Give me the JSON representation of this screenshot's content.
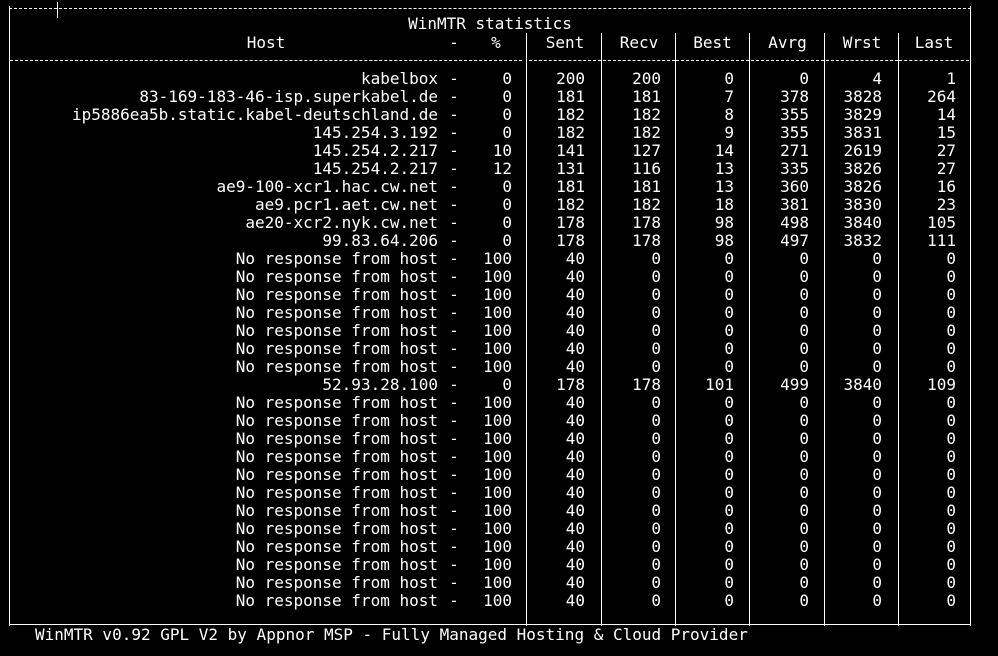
{
  "title": "WinMTR statistics",
  "headers": {
    "host": "Host",
    "dash": "-",
    "pct": "%",
    "sent": "Sent",
    "recv": "Recv",
    "best": "Best",
    "avrg": "Avrg",
    "wrst": "Wrst",
    "last": "Last"
  },
  "rows": [
    {
      "host": "kabelbox",
      "pct": "0",
      "sent": "200",
      "recv": "200",
      "best": "0",
      "avrg": "0",
      "wrst": "4",
      "last": "1"
    },
    {
      "host": "83-169-183-46-isp.superkabel.de",
      "pct": "0",
      "sent": "181",
      "recv": "181",
      "best": "7",
      "avrg": "378",
      "wrst": "3828",
      "last": "264"
    },
    {
      "host": "ip5886ea5b.static.kabel-deutschland.de",
      "pct": "0",
      "sent": "182",
      "recv": "182",
      "best": "8",
      "avrg": "355",
      "wrst": "3829",
      "last": "14"
    },
    {
      "host": "145.254.3.192",
      "pct": "0",
      "sent": "182",
      "recv": "182",
      "best": "9",
      "avrg": "355",
      "wrst": "3831",
      "last": "15"
    },
    {
      "host": "145.254.2.217",
      "pct": "10",
      "sent": "141",
      "recv": "127",
      "best": "14",
      "avrg": "271",
      "wrst": "2619",
      "last": "27"
    },
    {
      "host": "145.254.2.217",
      "pct": "12",
      "sent": "131",
      "recv": "116",
      "best": "13",
      "avrg": "335",
      "wrst": "3826",
      "last": "27"
    },
    {
      "host": "ae9-100-xcr1.hac.cw.net",
      "pct": "0",
      "sent": "181",
      "recv": "181",
      "best": "13",
      "avrg": "360",
      "wrst": "3826",
      "last": "16"
    },
    {
      "host": "ae9.pcr1.aet.cw.net",
      "pct": "0",
      "sent": "182",
      "recv": "182",
      "best": "18",
      "avrg": "381",
      "wrst": "3830",
      "last": "23"
    },
    {
      "host": "ae20-xcr2.nyk.cw.net",
      "pct": "0",
      "sent": "178",
      "recv": "178",
      "best": "98",
      "avrg": "498",
      "wrst": "3840",
      "last": "105"
    },
    {
      "host": "99.83.64.206",
      "pct": "0",
      "sent": "178",
      "recv": "178",
      "best": "98",
      "avrg": "497",
      "wrst": "3832",
      "last": "111"
    },
    {
      "host": "No response from host",
      "pct": "100",
      "sent": "40",
      "recv": "0",
      "best": "0",
      "avrg": "0",
      "wrst": "0",
      "last": "0"
    },
    {
      "host": "No response from host",
      "pct": "100",
      "sent": "40",
      "recv": "0",
      "best": "0",
      "avrg": "0",
      "wrst": "0",
      "last": "0"
    },
    {
      "host": "No response from host",
      "pct": "100",
      "sent": "40",
      "recv": "0",
      "best": "0",
      "avrg": "0",
      "wrst": "0",
      "last": "0"
    },
    {
      "host": "No response from host",
      "pct": "100",
      "sent": "40",
      "recv": "0",
      "best": "0",
      "avrg": "0",
      "wrst": "0",
      "last": "0"
    },
    {
      "host": "No response from host",
      "pct": "100",
      "sent": "40",
      "recv": "0",
      "best": "0",
      "avrg": "0",
      "wrst": "0",
      "last": "0"
    },
    {
      "host": "No response from host",
      "pct": "100",
      "sent": "40",
      "recv": "0",
      "best": "0",
      "avrg": "0",
      "wrst": "0",
      "last": "0"
    },
    {
      "host": "No response from host",
      "pct": "100",
      "sent": "40",
      "recv": "0",
      "best": "0",
      "avrg": "0",
      "wrst": "0",
      "last": "0"
    },
    {
      "host": "52.93.28.100",
      "pct": "0",
      "sent": "178",
      "recv": "178",
      "best": "101",
      "avrg": "499",
      "wrst": "3840",
      "last": "109"
    },
    {
      "host": "No response from host",
      "pct": "100",
      "sent": "40",
      "recv": "0",
      "best": "0",
      "avrg": "0",
      "wrst": "0",
      "last": "0"
    },
    {
      "host": "No response from host",
      "pct": "100",
      "sent": "40",
      "recv": "0",
      "best": "0",
      "avrg": "0",
      "wrst": "0",
      "last": "0"
    },
    {
      "host": "No response from host",
      "pct": "100",
      "sent": "40",
      "recv": "0",
      "best": "0",
      "avrg": "0",
      "wrst": "0",
      "last": "0"
    },
    {
      "host": "No response from host",
      "pct": "100",
      "sent": "40",
      "recv": "0",
      "best": "0",
      "avrg": "0",
      "wrst": "0",
      "last": "0"
    },
    {
      "host": "No response from host",
      "pct": "100",
      "sent": "40",
      "recv": "0",
      "best": "0",
      "avrg": "0",
      "wrst": "0",
      "last": "0"
    },
    {
      "host": "No response from host",
      "pct": "100",
      "sent": "40",
      "recv": "0",
      "best": "0",
      "avrg": "0",
      "wrst": "0",
      "last": "0"
    },
    {
      "host": "No response from host",
      "pct": "100",
      "sent": "40",
      "recv": "0",
      "best": "0",
      "avrg": "0",
      "wrst": "0",
      "last": "0"
    },
    {
      "host": "No response from host",
      "pct": "100",
      "sent": "40",
      "recv": "0",
      "best": "0",
      "avrg": "0",
      "wrst": "0",
      "last": "0"
    },
    {
      "host": "No response from host",
      "pct": "100",
      "sent": "40",
      "recv": "0",
      "best": "0",
      "avrg": "0",
      "wrst": "0",
      "last": "0"
    },
    {
      "host": "No response from host",
      "pct": "100",
      "sent": "40",
      "recv": "0",
      "best": "0",
      "avrg": "0",
      "wrst": "0",
      "last": "0"
    },
    {
      "host": "No response from host",
      "pct": "100",
      "sent": "40",
      "recv": "0",
      "best": "0",
      "avrg": "0",
      "wrst": "0",
      "last": "0"
    },
    {
      "host": "No response from host",
      "pct": "100",
      "sent": "40",
      "recv": "0",
      "best": "0",
      "avrg": "0",
      "wrst": "0",
      "last": "0"
    }
  ],
  "footer": "WinMTR v0.92 GPL V2 by Appnor MSP - Fully Managed Hosting & Cloud Provider"
}
